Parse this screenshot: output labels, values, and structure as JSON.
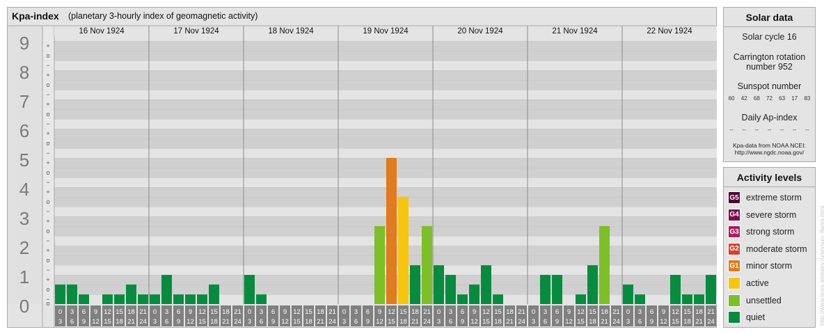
{
  "header": {
    "title": "Kpa-index",
    "subtitle": "(planetary 3-hourly index of geomagnetic activity)"
  },
  "chart_data": {
    "type": "bar",
    "title": "Kpa-index",
    "ylim": [
      0,
      9
    ],
    "y_tick_labels": [
      "0",
      "1",
      "2",
      "3",
      "4",
      "5",
      "6",
      "7",
      "8",
      "9"
    ],
    "sub_tick_labels": [
      "+",
      "o",
      "−"
    ],
    "days": [
      "16 Nov 1924",
      "17 Nov 1924",
      "18 Nov 1924",
      "19 Nov 1924",
      "20 Nov 1924",
      "21 Nov 1924",
      "22 Nov 1924"
    ],
    "interval_starts": [
      "0",
      "3",
      "6",
      "9",
      "12",
      "15",
      "18",
      "21"
    ],
    "interval_ends": [
      "3",
      "6",
      "9",
      "12",
      "15",
      "18",
      "21",
      "24"
    ],
    "values": [
      [
        0.67,
        0.67,
        0.33,
        0.0,
        0.33,
        0.33,
        0.67,
        0.33
      ],
      [
        0.33,
        1.0,
        0.33,
        0.33,
        0.33,
        0.67,
        0.0,
        0.0
      ],
      [
        1.0,
        0.33,
        0.0,
        0.0,
        0.0,
        0.0,
        0.0,
        0.0
      ],
      [
        0.0,
        0.0,
        0.0,
        2.67,
        5.0,
        3.67,
        1.33,
        2.67
      ],
      [
        1.33,
        1.0,
        0.33,
        0.67,
        1.33,
        0.33,
        0.0,
        0.0
      ],
      [
        0.0,
        1.0,
        1.0,
        0.0,
        0.33,
        1.33,
        2.67,
        0.0
      ],
      [
        0.67,
        0.33,
        0.0,
        0.0,
        1.0,
        0.33,
        0.33,
        1.0
      ]
    ],
    "level_colors": {
      "quiet": "#078c3f",
      "unsettled": "#7dbf26",
      "active": "#f7c50c",
      "minor_storm": "#e27a1e",
      "moderate_storm": "#d8412c",
      "strong_storm": "#b01c5b",
      "severe_storm": "#7f0a4c",
      "extreme_storm": "#4d0532"
    }
  },
  "solar": {
    "title": "Solar data",
    "cycle": "Solar cycle 16",
    "carrington_line1": "Carrington rotation",
    "carrington_line2": "number 952",
    "sunspot_title": "Sunspot number",
    "sunspot_values": [
      "60",
      "42",
      "68",
      "72",
      "63",
      "17",
      "83"
    ],
    "ap_title": "Daily Ap-index",
    "ap_values": [
      "--",
      "--",
      "--",
      "--",
      "--",
      "--",
      "--"
    ],
    "source_line1": "Kpa-data from NOAA NCEI:",
    "source_line2": "http://www.ngdc.noaa.gov/"
  },
  "activity": {
    "title": "Activity levels",
    "items": [
      {
        "badge": "G5",
        "label": "extreme storm",
        "color": "#4d0532"
      },
      {
        "badge": "G4",
        "label": "severe storm",
        "color": "#7f0a4c"
      },
      {
        "badge": "G3",
        "label": "strong storm",
        "color": "#b01c5b"
      },
      {
        "badge": "G2",
        "label": "moderate storm",
        "color": "#d8412c"
      },
      {
        "badge": "G1",
        "label": "minor storm",
        "color": "#e27a1e"
      },
      {
        "badge": "",
        "label": "active",
        "color": "#f7c50c"
      },
      {
        "badge": "",
        "label": "unsettled",
        "color": "#7dbf26"
      },
      {
        "badge": "",
        "label": "quiet",
        "color": "#078c3f"
      }
    ]
  },
  "watermark": "http://www.tesis.lebedev.ru/en/sun_flares.html"
}
